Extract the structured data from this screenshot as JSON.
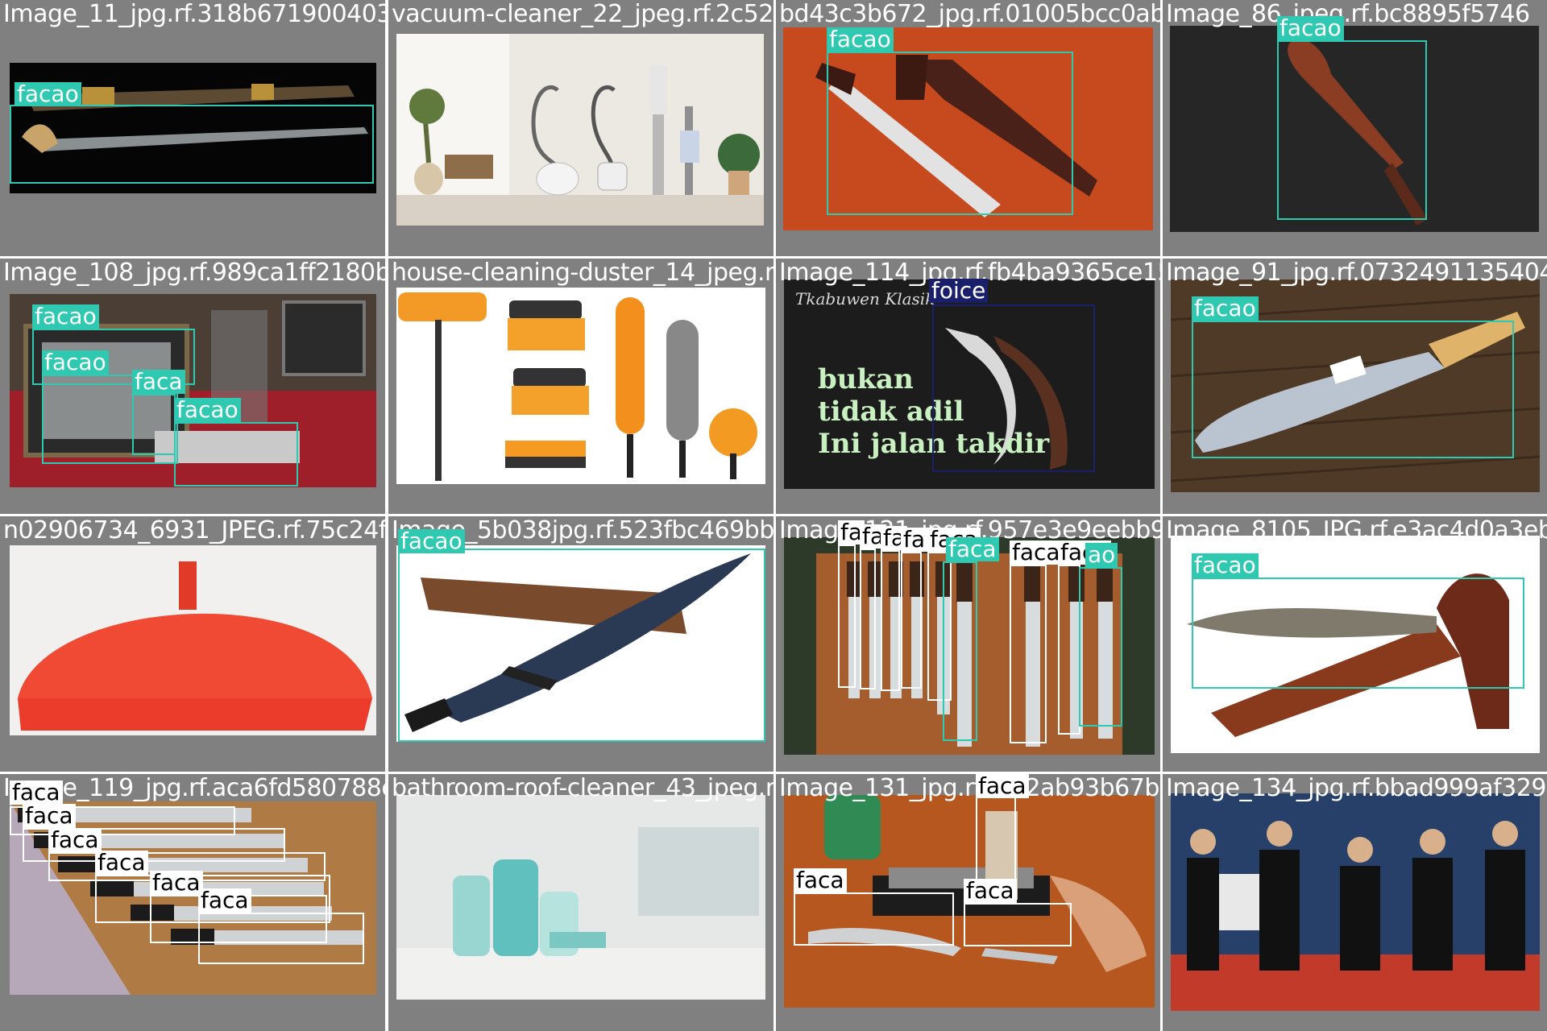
{
  "colors": {
    "facao": "#2ec9b0",
    "faca": "#ffffff",
    "foice": "#1a1f6b",
    "cell_bg": "#808080"
  },
  "class_names": {
    "facao": "facao",
    "faca": "faca",
    "foice": "foice"
  },
  "tiles": [
    {
      "filename": "Image_11_jpg.rf.318b671900403c2e09450c712",
      "scene": "sword-on-black",
      "labels": [
        {
          "text": "facao",
          "cls": "facao"
        }
      ]
    },
    {
      "filename": "vacuum-cleaner_22_jpeg.rf.2c52bd43c3b672",
      "scene": "vacuums",
      "labels": []
    },
    {
      "filename": "bd43c3b672_jpg.rf.01005bcc0ab5bbdaa99d8a1",
      "scene": "knife-orange",
      "labels": [
        {
          "text": "facao",
          "cls": "facao"
        }
      ]
    },
    {
      "filename": "Image_86_jpeg.rf.bc8895f5746",
      "scene": "machete-dark",
      "labels": [
        {
          "text": "facao",
          "cls": "facao"
        }
      ]
    },
    {
      "filename": "Image_108_jpg.rf.989ca1ff2180bf34dfa90f31",
      "scene": "exhibit",
      "labels": [
        {
          "text": "facao",
          "cls": "facao"
        },
        {
          "text": "facao",
          "cls": "facao"
        },
        {
          "text": "faca",
          "cls": "facao"
        },
        {
          "text": "facao",
          "cls": "facao"
        }
      ]
    },
    {
      "filename": "house-cleaning-duster_14_jpeg.rf.bf5390114",
      "scene": "brushes",
      "labels": []
    },
    {
      "filename": "Image_114_jpg.rf.fb4ba9365ce1525d1913_jpg.rf.0732491135404",
      "scene": "sickle",
      "labels": [
        {
          "text": "foice",
          "cls": "foice"
        }
      ],
      "script": "Tkabuwen Klasik",
      "overlay": [
        "bukan",
        "tidak adil",
        "Ini jalan takdir"
      ]
    },
    {
      "filename": "Image_91_jpg.rf.0732491135404",
      "scene": "machete-wood",
      "labels": [
        {
          "text": "facao",
          "cls": "facao"
        }
      ]
    },
    {
      "filename": "n02906734_6931_JPEG.rf.75c24f",
      "scene": "broom",
      "labels": []
    },
    {
      "filename": "Image_5b038jpg.rf.523fbc469bb580f5216a121",
      "scene": "kukri",
      "labels": [
        {
          "text": "facao",
          "cls": "facao"
        }
      ]
    },
    {
      "filename": "Image_121_jpg.rf.957e3e9eebb9bf3992d8185",
      "scene": "knife-rack",
      "labels": [
        {
          "text": "fa",
          "cls": "faca"
        },
        {
          "text": "fa",
          "cls": "faca"
        },
        {
          "text": "fa",
          "cls": "faca"
        },
        {
          "text": "fa",
          "cls": "faca"
        },
        {
          "text": "faca",
          "cls": "faca"
        },
        {
          "text": "faca",
          "cls": "facao"
        },
        {
          "text": "faca",
          "cls": "faca"
        },
        {
          "text": "faca",
          "cls": "faca"
        },
        {
          "text": "ao",
          "cls": "facao"
        }
      ]
    },
    {
      "filename": "Image_8105_JPG.rf.e3ac4d0a3eb",
      "scene": "keris",
      "labels": [
        {
          "text": "facao",
          "cls": "facao"
        }
      ]
    },
    {
      "filename": "Image_119_jpg.rf.aca6fd580788cbbdb6bd1155",
      "scene": "chef-knives",
      "labels": [
        {
          "text": "faca",
          "cls": "faca"
        },
        {
          "text": "faca",
          "cls": "faca"
        },
        {
          "text": "faca",
          "cls": "faca"
        },
        {
          "text": "faca",
          "cls": "faca"
        },
        {
          "text": "faca",
          "cls": "faca"
        },
        {
          "text": "faca",
          "cls": "faca"
        }
      ]
    },
    {
      "filename": "bathroom-roof-cleaner_43_jpeg.rf.f10c9",
      "scene": "spray-bottles",
      "labels": []
    },
    {
      "filename": "Image_131_jpg.rf.f7a2ab93b67b527ae396341",
      "scene": "sharpening",
      "labels": [
        {
          "text": "faca",
          "cls": "faca"
        },
        {
          "text": "faca",
          "cls": "faca"
        },
        {
          "text": "faca",
          "cls": "faca"
        }
      ]
    },
    {
      "filename": "Image_134_jpg.rf.bbad999af329b",
      "scene": "martial-arts",
      "labels": []
    }
  ]
}
